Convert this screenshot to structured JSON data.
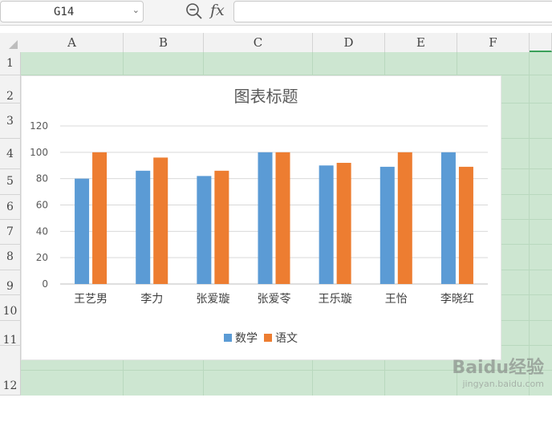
{
  "formula_bar": {
    "name_box_value": "G14",
    "fx_label": "fx",
    "formula_value": ""
  },
  "columns": [
    "A",
    "B",
    "C",
    "D",
    "E",
    "F"
  ],
  "rows": [
    "1",
    "2",
    "3",
    "4",
    "5",
    "6",
    "7",
    "8",
    "9",
    "10",
    "11",
    "12"
  ],
  "selected_column": "G",
  "colors": {
    "series_math": "#5b9bd5",
    "series_chinese": "#ed7d31",
    "grid_bg": "#cde6d1"
  },
  "chart_data": {
    "type": "bar",
    "title": "图表标题",
    "categories": [
      "王艺男",
      "李力",
      "张爱璇",
      "张爱苓",
      "王乐璇",
      "王怡",
      "李晓红"
    ],
    "series": [
      {
        "name": "数学",
        "values": [
          80,
          86,
          82,
          100,
          90,
          89,
          100
        ]
      },
      {
        "name": "语文",
        "values": [
          100,
          96,
          86,
          100,
          92,
          100,
          89
        ]
      }
    ],
    "ylim": [
      0,
      120
    ],
    "yticks": [
      0,
      20,
      40,
      60,
      80,
      100,
      120
    ],
    "grid": true,
    "legend_position": "bottom"
  },
  "watermark": {
    "main": "Baidu经验",
    "sub": "jingyan.baidu.com"
  }
}
